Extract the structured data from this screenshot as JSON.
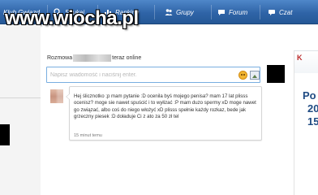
{
  "nav": {
    "items": [
      {
        "label": "Klub Gwiazd",
        "icon": "people-icon"
      },
      {
        "label": "Szukaj",
        "icon": "search-icon"
      },
      {
        "label": "Ranking",
        "icon": "ranking-icon"
      },
      {
        "label": "Grupy",
        "icon": "group-icon"
      },
      {
        "label": "Forum",
        "icon": "forum-icon"
      },
      {
        "label": "Czat",
        "icon": "chat-icon"
      }
    ]
  },
  "watermark": "www.wiocha.pl",
  "chat": {
    "title_prefix": "Rozmowa",
    "title_suffix": "teraz online",
    "input_placeholder": "Napisz wiadomość i naciśnij enter."
  },
  "message": {
    "text": "Hej ślicznotko ;p mam pytanie :D ocenila byś mojego penisa? mam 17 lat plisss ocenisz? moge sie nawet spuścić i to wyłizać :P mam duzo spermy xD moge nawet go związać, albo coś do niego włożyć xD plisss spełnie każdy rozkaz, bede jak grzeczny piesek :D doładuje Ci z ato za 50 zł tel",
    "time": "15 minut temu"
  },
  "right_panel": {
    "letter": "K",
    "lines": [
      "Po",
      "20",
      "15"
    ]
  },
  "colors": {
    "nav_bar": "#2f64a7",
    "input_border": "#79aee0",
    "link_blue": "#1f4b83",
    "accent_red": "#bc2b2b"
  }
}
